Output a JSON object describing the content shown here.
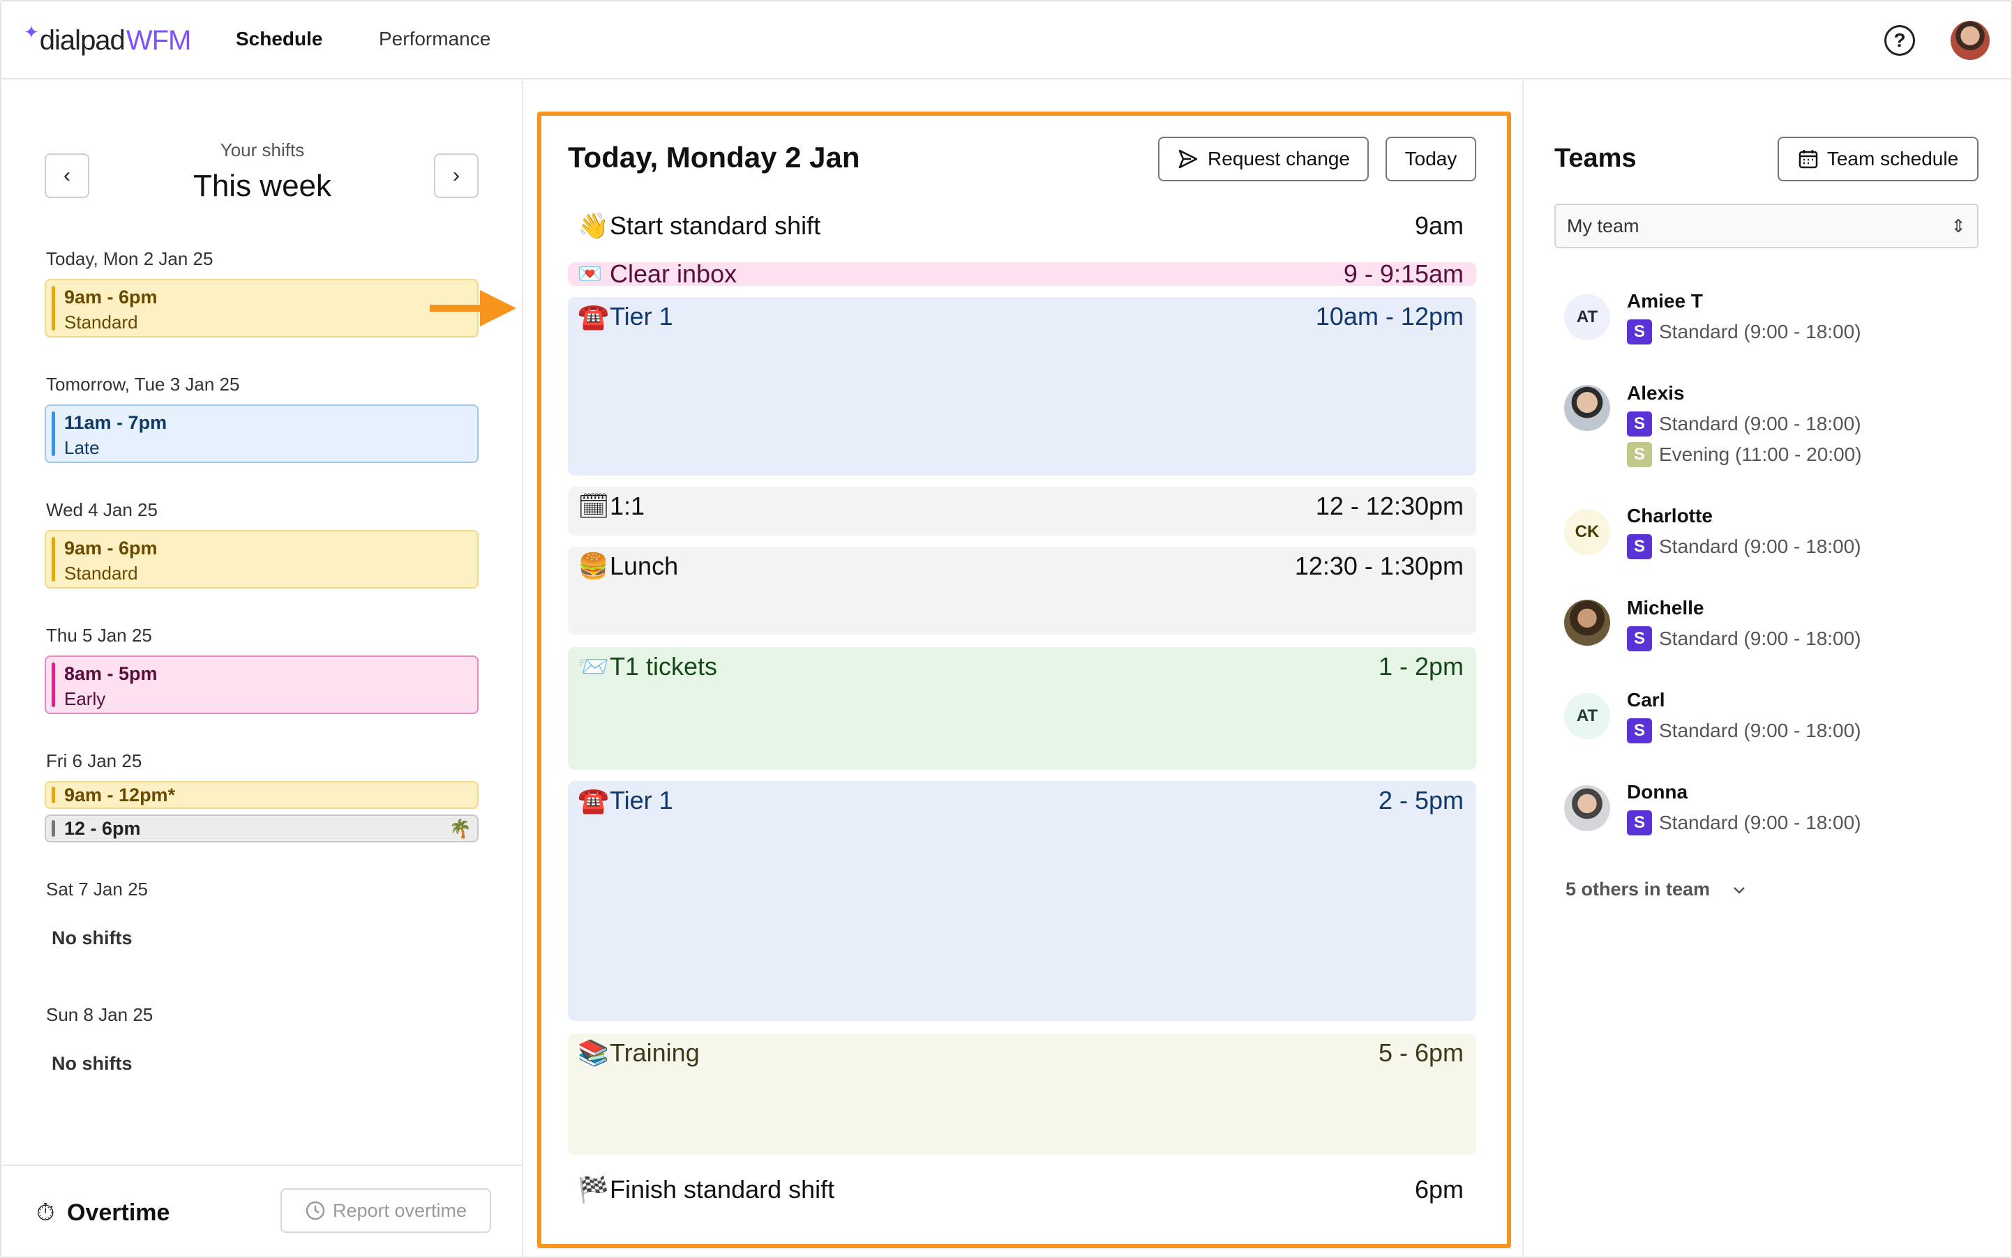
{
  "header": {
    "logo_word": "dialpad",
    "logo_suffix": "WFM",
    "nav": {
      "schedule": "Schedule",
      "performance": "Performance"
    },
    "help_label": "?"
  },
  "week": {
    "caption": "Your shifts",
    "title": "This week",
    "prev_icon": "chevron-left-icon",
    "next_icon": "chevron-right-icon",
    "days": [
      {
        "label": "Today, Mon 2 Jan 25",
        "shifts": [
          {
            "time": "9am - 6pm",
            "name": "Standard",
            "color": "#fdf1c4"
          }
        ]
      },
      {
        "label": "Tomorrow, Tue 3 Jan 25",
        "shifts": [
          {
            "time": "11am - 7pm",
            "name": "Late",
            "color": "#e6f1fd"
          }
        ]
      },
      {
        "label": "Wed 4 Jan 25",
        "shifts": [
          {
            "time": "9am - 6pm",
            "name": "Standard",
            "color": "#fdf1c4"
          }
        ]
      },
      {
        "label": "Thu 5 Jan 25",
        "shifts": [
          {
            "time": "8am - 5pm",
            "name": "Early",
            "color": "#fde1f1"
          }
        ]
      },
      {
        "label": "Fri 6 Jan 25",
        "shifts": [
          {
            "time": "9am - 12pm*",
            "color": "#fdf1c4"
          },
          {
            "time": "12 - 6pm",
            "icon": "🌴",
            "color": "#ececec"
          }
        ]
      },
      {
        "label": "Sat 7 Jan 25",
        "empty": "No shifts"
      },
      {
        "label": "Sun 8 Jan 25",
        "empty": "No shifts"
      }
    ]
  },
  "overtime": {
    "icon": "⏱",
    "label": "Overtime",
    "button": "Report overtime"
  },
  "today": {
    "title": "Today, Monday 2 Jan",
    "request_change": "Request change",
    "today_button": "Today",
    "activities": [
      {
        "emoji": "👋",
        "name": "Start standard shift",
        "time": "9am"
      },
      {
        "emoji": "💌",
        "name": "Clear inbox",
        "time": "9 - 9:15am"
      },
      {
        "emoji": "☎️",
        "name": "Tier 1",
        "time": "10am - 12pm"
      },
      {
        "emoji": "🗓",
        "name": "1:1",
        "time": "12 - 12:30pm"
      },
      {
        "emoji": "🍔",
        "name": "Lunch",
        "time": "12:30 - 1:30pm"
      },
      {
        "emoji": "📨",
        "name": "T1 tickets",
        "time": "1 - 2pm"
      },
      {
        "emoji": "☎️",
        "name": "Tier 1",
        "time": "2 - 5pm"
      },
      {
        "emoji": "📚",
        "name": "Training",
        "time": "5 - 6pm"
      },
      {
        "emoji": "🏁",
        "name": "Finish standard shift",
        "time": "6pm"
      }
    ]
  },
  "teams": {
    "title": "Teams",
    "team_schedule": "Team schedule",
    "selected_team": "My team",
    "members": [
      {
        "initials": "AT",
        "name": "Amiee T",
        "shifts": [
          {
            "badge": "S",
            "label": "Standard (9:00 - 18:00)",
            "color": "#5b32d6"
          }
        ]
      },
      {
        "initials": "",
        "name": "Alexis",
        "shifts": [
          {
            "badge": "S",
            "label": "Standard (9:00 - 18:00)",
            "color": "#5b32d6"
          },
          {
            "badge": "S",
            "label": "Evening (11:00 - 20:00)",
            "color": "#c3c78a"
          }
        ]
      },
      {
        "initials": "CK",
        "name": "Charlotte",
        "shifts": [
          {
            "badge": "S",
            "label": "Standard (9:00 - 18:00)",
            "color": "#5b32d6"
          }
        ]
      },
      {
        "initials": "",
        "name": "Michelle",
        "shifts": [
          {
            "badge": "S",
            "label": "Standard (9:00 - 18:00)",
            "color": "#5b32d6"
          }
        ]
      },
      {
        "initials": "AT",
        "name": "Carl",
        "shifts": [
          {
            "badge": "S",
            "label": "Standard (9:00 - 18:00)",
            "color": "#5b32d6"
          }
        ]
      },
      {
        "initials": "",
        "name": "Donna",
        "shifts": [
          {
            "badge": "S",
            "label": "Standard (9:00 - 18:00)",
            "color": "#5b32d6"
          }
        ]
      }
    ],
    "others": "5 others in team"
  },
  "colors": {
    "brand": "#7c52ff",
    "highlight": "#f7941d",
    "badge_primary": "#5b32d6"
  }
}
